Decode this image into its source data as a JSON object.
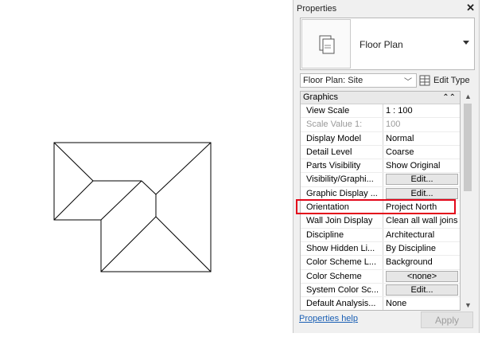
{
  "properties_panel": {
    "title": "Properties",
    "close_glyph": "✕",
    "type_selector": {
      "name": "Floor Plan",
      "icon": "floor-plan-icon"
    },
    "instance_selector": {
      "value": "Floor Plan: Site"
    },
    "edit_type_label": "Edit Type",
    "group_header": "Graphics",
    "rows": [
      {
        "label": "View Scale",
        "value": "1 : 100",
        "kind": "text"
      },
      {
        "label": "Scale Value    1:",
        "value": "100",
        "kind": "dim"
      },
      {
        "label": "Display Model",
        "value": "Normal",
        "kind": "text"
      },
      {
        "label": "Detail Level",
        "value": "Coarse",
        "kind": "text"
      },
      {
        "label": "Parts Visibility",
        "value": "Show Original",
        "kind": "text"
      },
      {
        "label": "Visibility/Graphi...",
        "value": "Edit...",
        "kind": "button"
      },
      {
        "label": "Graphic Display ...",
        "value": "Edit...",
        "kind": "button"
      },
      {
        "label": "Orientation",
        "value": "Project North",
        "kind": "text",
        "highlighted": true
      },
      {
        "label": "Wall Join Display",
        "value": "Clean all wall joins",
        "kind": "text"
      },
      {
        "label": "Discipline",
        "value": "Architectural",
        "kind": "text"
      },
      {
        "label": "Show Hidden Li...",
        "value": "By Discipline",
        "kind": "text"
      },
      {
        "label": "Color Scheme L...",
        "value": "Background",
        "kind": "text"
      },
      {
        "label": "Color Scheme",
        "value": "<none>",
        "kind": "button"
      },
      {
        "label": "System Color Sc...",
        "value": "Edit...",
        "kind": "button"
      },
      {
        "label": "Default Analysis...",
        "value": "None",
        "kind": "text"
      }
    ],
    "help_link": "Properties help",
    "apply_label": "Apply",
    "highlight_color": "#e3081b"
  }
}
